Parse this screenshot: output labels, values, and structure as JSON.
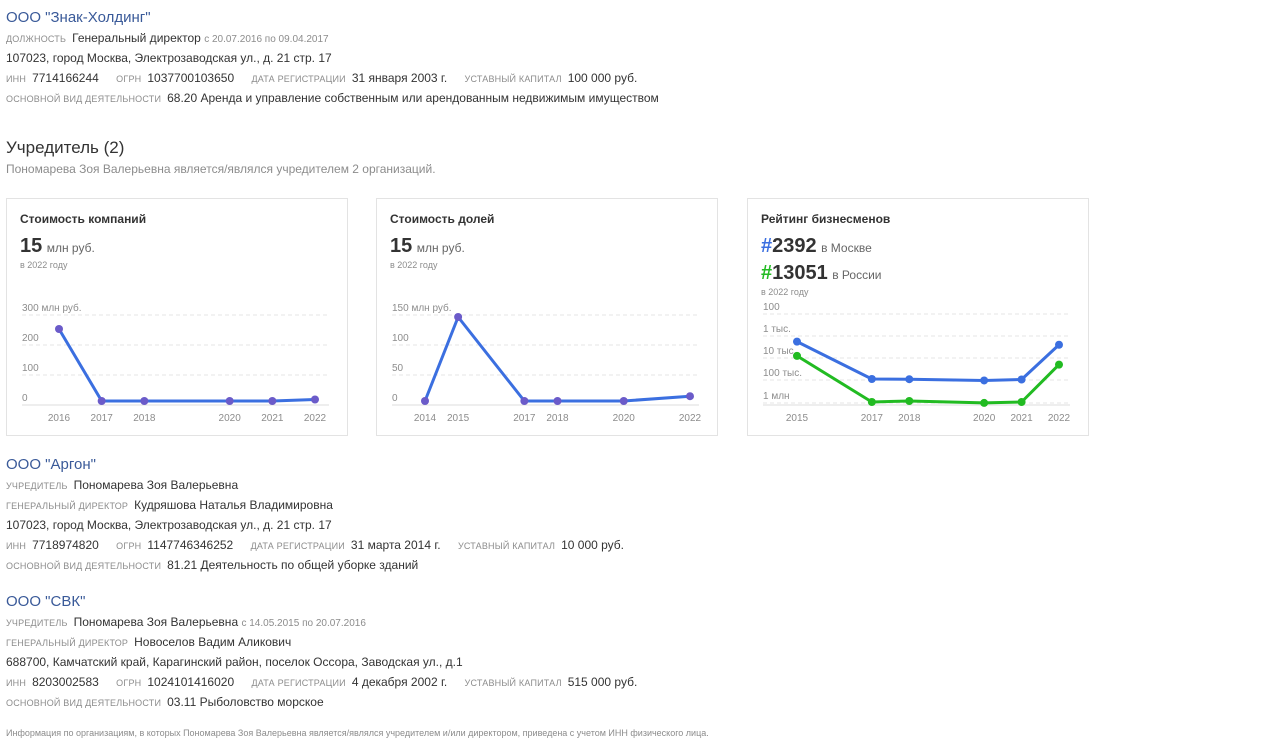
{
  "org1": {
    "title": "ООО \"Знак-Холдинг\"",
    "role_label": "должность",
    "role": "Генеральный директор",
    "dates": "с 20.07.2016 по 09.04.2017",
    "address": "107023, город Москва, Электрозаводская ул., д. 21 стр. 17",
    "inn_label": "инн",
    "inn": "7714166244",
    "ogrn_label": "огрн",
    "ogrn": "1037700103650",
    "reg_label": "дата регистрации",
    "reg": "31 января 2003 г.",
    "capital_label": "уставный капитал",
    "capital": "100 000 руб.",
    "activity_label": "основной вид деятельности",
    "activity": "68.20 Аренда и управление собственным или арендованным недвижимым имуществом"
  },
  "section": {
    "title": "Учредитель (2)",
    "subtitle": "Пономарева Зоя Валерьевна является/являлся учредителем 2 организаций."
  },
  "cards": {
    "companies": {
      "title": "Стоимость компаний",
      "value": "15",
      "unit": "млн руб.",
      "note": "в 2022 году"
    },
    "shares": {
      "title": "Стоимость долей",
      "value": "15",
      "unit": "млн руб.",
      "note": "в 2022 году"
    },
    "rating": {
      "title": "Рейтинг бизнесменов",
      "moscow": "2392",
      "moscow_label": "в Москве",
      "russia": "13051",
      "russia_label": "в России",
      "note": "в 2022 году"
    }
  },
  "chart_data": [
    {
      "type": "line",
      "y_ticks": [
        "0",
        "100",
        "200",
        "300 млн руб."
      ],
      "x": [
        "2016",
        "2017",
        "2018",
        "2020",
        "2021",
        "2022"
      ],
      "series": [
        {
          "values": [
            240,
            0,
            0,
            0,
            0,
            5
          ]
        }
      ],
      "ylim": [
        0,
        300
      ],
      "colors": {
        "line": "#3b6fe0",
        "point": "#6b5bc9"
      }
    },
    {
      "type": "line",
      "y_ticks": [
        "0",
        "50",
        "100",
        "150 млн руб."
      ],
      "x": [
        "2014",
        "2015",
        "2017",
        "2018",
        "2020",
        "2022"
      ],
      "series": [
        {
          "values": [
            0,
            140,
            0,
            0,
            0,
            8
          ]
        }
      ],
      "ylim": [
        0,
        150
      ],
      "colors": {
        "line": "#3b6fe0",
        "point": "#6b5bc9"
      }
    },
    {
      "type": "line",
      "y_ticks": [
        "100",
        "1 тыс.",
        "10 тыс.",
        "100 тыс.",
        "1 млн"
      ],
      "x": [
        "2015",
        "2017",
        "2018",
        "2020",
        "2021",
        "2022"
      ],
      "series": [
        {
          "values": [
            1800,
            90000,
            92000,
            105000,
            95000,
            2500
          ]
        },
        {
          "values": [
            8000,
            1000000,
            900000,
            1100000,
            1000000,
            20000
          ]
        }
      ],
      "log_scale": true,
      "colors": {
        "moscow": "#3b6fe0",
        "russia": "#22bb22"
      }
    }
  ],
  "org2": {
    "title": "ООО \"Аргон\"",
    "founder_label": "учредитель",
    "founder": "Пономарева Зоя Валерьевна",
    "director_label": "генеральный директор",
    "director": "Кудряшова Наталья Владимировна",
    "address": "107023, город Москва, Электрозаводская ул., д. 21 стр. 17",
    "inn_label": "инн",
    "inn": "7718974820",
    "ogrn_label": "огрн",
    "ogrn": "1147746346252",
    "reg_label": "дата регистрации",
    "reg": "31 марта 2014 г.",
    "capital_label": "уставный капитал",
    "capital": "10 000 руб.",
    "activity_label": "основной вид деятельности",
    "activity": "81.21 Деятельность по общей уборке зданий"
  },
  "org3": {
    "title": "ООО \"СВК\"",
    "founder_label": "учредитель",
    "founder": "Пономарева Зоя Валерьевна",
    "founder_dates": "с 14.05.2015 по 20.07.2016",
    "director_label": "генеральный директор",
    "director": "Новоселов Вадим Аликович",
    "address": "688700, Камчатский край, Карагинский район, поселок Оссора, Заводская ул., д.1",
    "inn_label": "инн",
    "inn": "8203002583",
    "ogrn_label": "огрн",
    "ogrn": "1024101416020",
    "reg_label": "дата регистрации",
    "reg": "4 декабря 2002 г.",
    "capital_label": "уставный капитал",
    "capital": "515 000 руб.",
    "activity_label": "основной вид деятельности",
    "activity": "03.11 Рыболовство морское"
  },
  "footnote": "Информация по организациям, в которых Пономарева Зоя Валерьевна является/являлся учредителем и/или директором, приведена с учетом ИНН физического лица."
}
